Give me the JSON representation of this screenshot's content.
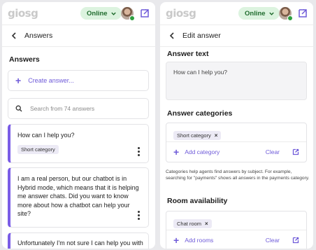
{
  "brand": {
    "logo_text": "giosg",
    "accent": "#7a5ce6",
    "status_bg": "#dcf3df",
    "status_color": "#1f6b2d"
  },
  "status": {
    "label": "Online"
  },
  "left": {
    "header_title": "Answers",
    "section_title": "Answers",
    "create_label": "Create answer...",
    "search_placeholder": "Search from 74 answers",
    "answers": [
      {
        "text": "How can I help you?",
        "category": "Short category"
      },
      {
        "text": "I am a real person, but our chatbot is in Hybrid mode, which means that it is helping me answer chats. Did you want to know more about how a chatbot can help your site?"
      },
      {
        "text": "Unfortunately I'm not sure I can help you with"
      }
    ]
  },
  "right": {
    "header_title": "Edit answer",
    "answer_text_label": "Answer text",
    "answer_text_value": "How can I help you?",
    "categories_label": "Answer categories",
    "category_chip": "Short category",
    "add_category_label": "Add category",
    "clear_label": "Clear",
    "categories_help": "Categories help agents find answers by subject. For example, searching for \"payments\" shows all answers in the payments category.",
    "room_label": "Room availability",
    "room_chip": "Chat room",
    "add_rooms_label": "Add rooms",
    "room_clear_label": "Clear"
  }
}
